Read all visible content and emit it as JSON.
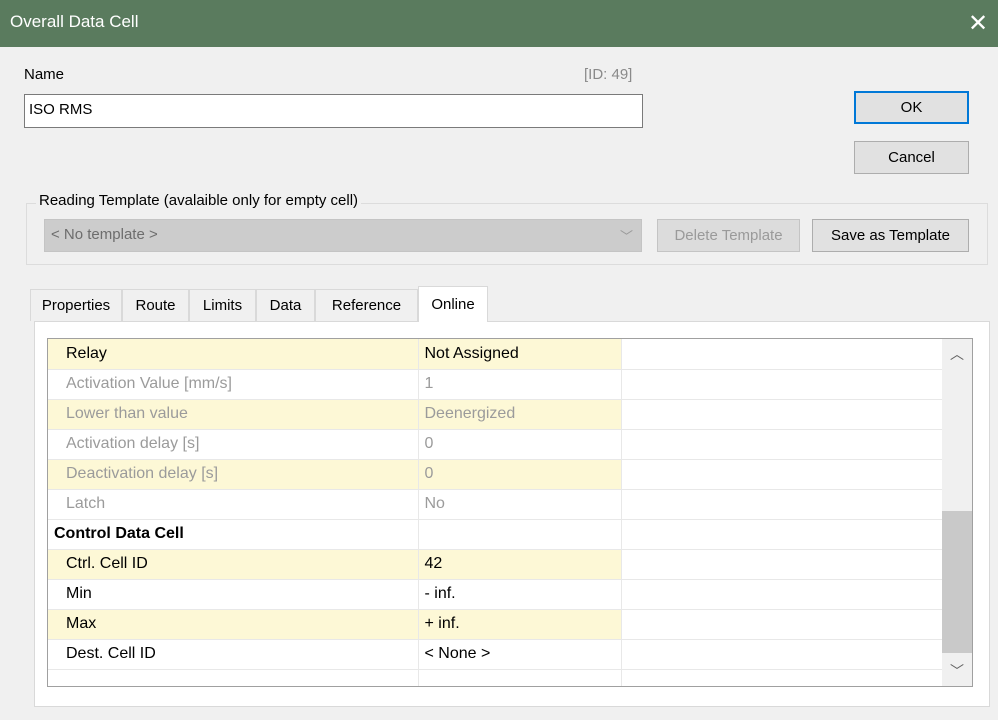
{
  "window": {
    "title": "Overall Data Cell"
  },
  "name_field": {
    "label": "Name",
    "value": "ISO RMS",
    "id_label": "[ID: 49]"
  },
  "buttons": {
    "ok": "OK",
    "cancel": "Cancel",
    "delete_template": "Delete Template",
    "save_template": "Save as Template"
  },
  "template": {
    "legend": "Reading Template (avalaible only for empty cell)",
    "selected": "< No template >"
  },
  "tabs": [
    {
      "label": "Properties"
    },
    {
      "label": "Route"
    },
    {
      "label": "Limits"
    },
    {
      "label": "Data"
    },
    {
      "label": "Reference"
    },
    {
      "label": "Online"
    }
  ],
  "rows": [
    {
      "name": "Relay",
      "value": "Not Assigned"
    },
    {
      "name": "Activation Value [mm/s]",
      "value": "1"
    },
    {
      "name": "Lower than value",
      "value": "Deenergized"
    },
    {
      "name": "Activation delay [s]",
      "value": "0"
    },
    {
      "name": "Deactivation delay [s]",
      "value": "0"
    },
    {
      "name": "Latch",
      "value": "No"
    },
    {
      "name": "Control Data Cell",
      "value": ""
    },
    {
      "name": "Ctrl. Cell ID",
      "value": "42"
    },
    {
      "name": "Min",
      "value": "- inf."
    },
    {
      "name": "Max",
      "value": "+ inf."
    },
    {
      "name": "Dest. Cell ID",
      "value": "< None >"
    }
  ],
  "colors": {
    "titlebar": "#5a7b5e",
    "row_highlight": "#fdf8d6",
    "accent": "#0078d7"
  }
}
